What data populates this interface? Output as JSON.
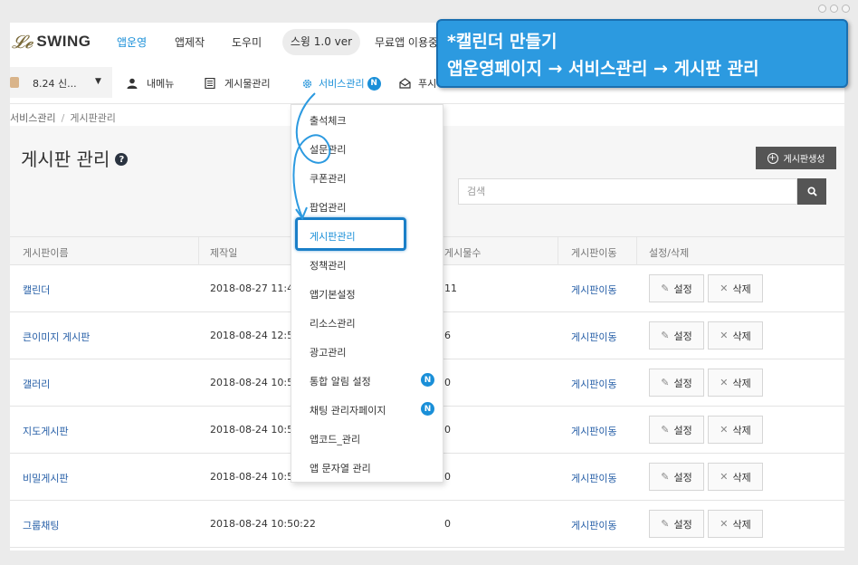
{
  "brand": {
    "logo_mark": "𝓛𝓮",
    "name": "SWING"
  },
  "top_nav": {
    "items": [
      {
        "label": "앱운영",
        "active": true
      },
      {
        "label": "앱제작",
        "active": false
      },
      {
        "label": "도우미",
        "active": false
      }
    ],
    "version_pill": "스윙 1.0 ver",
    "free_app_link": "무료앱 이용중"
  },
  "sub_nav": {
    "project_selector": "8.24 신...",
    "items": [
      {
        "label": "내메뉴",
        "icon": "user-icon"
      },
      {
        "label": "게시물관리",
        "icon": "document-icon"
      },
      {
        "label": "서비스관리",
        "icon": "gear-icon",
        "badge": "N",
        "active": true
      },
      {
        "label": "푸시",
        "icon": "envelope-icon"
      }
    ]
  },
  "breadcrumb": {
    "parent": "서비스관리",
    "separator": "/",
    "current": "게시판관리"
  },
  "page": {
    "title": "게시판 관리",
    "create_button": "게시판생성",
    "search_placeholder": "검색"
  },
  "table": {
    "headers": [
      "게시판이름",
      "제작일",
      "게시물수",
      "게시판이동",
      "설정/삭제"
    ],
    "rows": [
      {
        "name": "캘린더",
        "date": "2018-08-27 11:46:",
        "count": "11",
        "move": "게시판이동"
      },
      {
        "name": "큰이미지 게시판",
        "date": "2018-08-24 12:58:",
        "count": "6",
        "move": "게시판이동"
      },
      {
        "name": "갤러리",
        "date": "2018-08-24 10:50:",
        "count": "0",
        "move": "게시판이동"
      },
      {
        "name": "지도게시판",
        "date": "2018-08-24 10:50:",
        "count": "0",
        "move": "게시판이동"
      },
      {
        "name": "비밀게시판",
        "date": "2018-08-24 10:50:",
        "count": "0",
        "move": "게시판이동"
      },
      {
        "name": "그룹채팅",
        "date": "2018-08-24 10:50:22",
        "count": "0",
        "move": "게시판이동"
      }
    ],
    "edit_label": "설정",
    "delete_label": "삭제"
  },
  "dropdown": {
    "items": [
      {
        "label": "출석체크"
      },
      {
        "label": "설문관리"
      },
      {
        "label": "쿠폰관리"
      },
      {
        "label": "팝업관리"
      },
      {
        "label": "게시판관리",
        "highlighted": true
      },
      {
        "label": "정책관리"
      },
      {
        "label": "앱기본설정"
      },
      {
        "label": "리소스관리"
      },
      {
        "label": "광고관리"
      },
      {
        "label": "통합 알림 설정",
        "badge": "N"
      },
      {
        "label": "채팅 관리자페이지",
        "badge": "N"
      },
      {
        "label": "앱코드_관리"
      },
      {
        "label": "앱 문자열 관리"
      }
    ]
  },
  "callout": {
    "line1": "*캘린더 만들기",
    "line2": "앱운영페이지 → 서비스관리 → 게시판 관리"
  },
  "colors": {
    "accent": "#1a8fd8",
    "callout": "#2c9ae0",
    "link": "#2860a8",
    "dark_button": "#555555"
  }
}
